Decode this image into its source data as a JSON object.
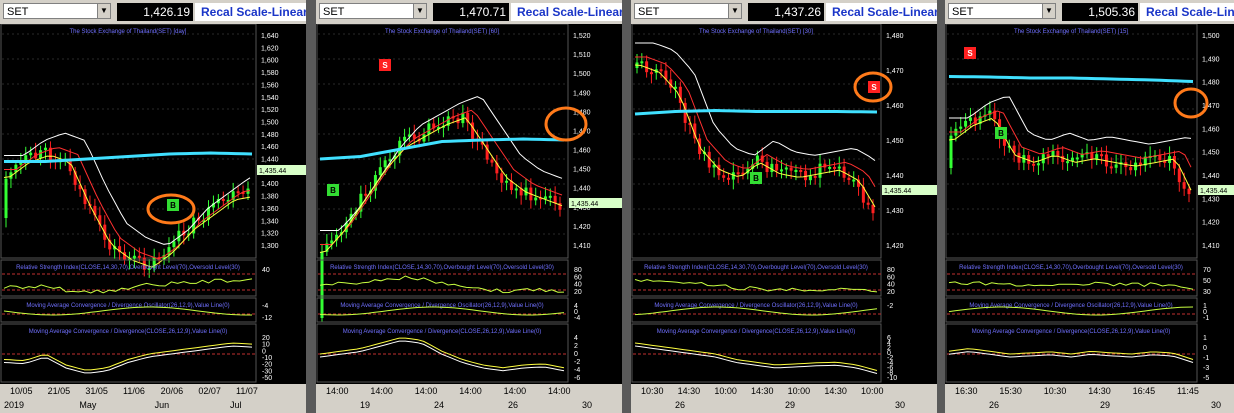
{
  "panels": [
    {
      "symbol": "SET",
      "price": "1,426.19",
      "recal_label": "Recal Scale-Linear",
      "chart_title": "The Stock Exchange of Thailand(SET) [day]",
      "price_axis": [
        "1,640",
        "1,620",
        "1,600",
        "1,580",
        "1,560",
        "1,540",
        "1,520",
        "1,500",
        "1,480",
        "1,460",
        "1,440",
        "1,420",
        "1,400",
        "1,380",
        "1,360",
        "1,340",
        "1,320",
        "1,300"
      ],
      "last_price_tag": "1,435.44",
      "rsi_label": "Relative Strength Index(CLOSE,14,30,70),Overbought Level(70),Oversold Level(30)",
      "rsi_axis": [
        "40"
      ],
      "macd_osc_label": "Moving Average Convergence / Divergence Oscillator(26,12,9),Value Line(0)",
      "macd_osc_axis": [
        "-4",
        "-12"
      ],
      "macd_label": "Moving Average Convergence / Divergence(CLOSE,26,12,9),Value Line(0)",
      "macd_axis": [
        "20",
        "10",
        "0",
        "-10",
        "-20",
        "-30",
        "-50"
      ],
      "time_labels": [
        "10/05",
        "21/05",
        "31/05",
        "11/06",
        "20/06",
        "02/07",
        "11/07"
      ],
      "date_labels": [
        "2019",
        "May",
        "Jun",
        "Jul"
      ],
      "signals": [
        {
          "type": "B",
          "text": "B"
        }
      ],
      "highlight": "buy-signal"
    },
    {
      "symbol": "SET",
      "price": "1,470.71",
      "recal_label": "Recal Scale-Linear",
      "chart_title": "The Stock Exchange of Thailand(SET) [60]",
      "price_axis": [
        "1,520",
        "1,510",
        "1,500",
        "1,490",
        "1,480",
        "1,470",
        "1,460",
        "1,450",
        "1,440",
        "1,430",
        "1,420",
        "1,410"
      ],
      "last_price_tag": "1,435.44",
      "rsi_label": "Relative Strength Index(CLOSE,14,30,70),Overbought Level(70),Oversold Level(30)",
      "rsi_axis": [
        "80",
        "60",
        "40",
        "20"
      ],
      "macd_osc_label": "Moving Average Convergence / Divergence Oscillator(26,12,9),Value Line(0)",
      "macd_osc_axis": [
        "4",
        "0",
        "-4"
      ],
      "macd_label": "Moving Average Convergence / Divergence(CLOSE,26,12,9),Value Line(0)",
      "macd_axis": [
        "4",
        "2",
        "0",
        "-2",
        "-4",
        "-6"
      ],
      "time_labels": [
        "14:00",
        "14:00",
        "14:00",
        "14:00",
        "14:00",
        "14:00"
      ],
      "date_labels": [
        "19",
        "24",
        "26",
        "30"
      ],
      "signals": [
        {
          "type": "B",
          "text": "B"
        },
        {
          "type": "S",
          "text": "S"
        }
      ],
      "highlight": "sell-signal"
    },
    {
      "symbol": "SET",
      "price": "1,437.26",
      "recal_label": "Recal Scale-Linear",
      "chart_title": "The Stock Exchange of Thailand(SET) [30]",
      "price_axis": [
        "1,480",
        "1,470",
        "1,460",
        "1,450",
        "1,440",
        "1,430",
        "1,420"
      ],
      "last_price_tag": "1,435.44",
      "rsi_label": "Relative Strength Index(CLOSE,14,30,70),Overbought Level(70),Oversold Level(30)",
      "rsi_axis": [
        "80",
        "60",
        "40",
        "20"
      ],
      "macd_osc_label": "Moving Average Convergence / Divergence Oscillator(26,12,9),Value Line(0)",
      "macd_osc_axis": [
        "-2"
      ],
      "macd_label": "Moving Average Convergence / Divergence(CLOSE,26,12,9),Value Line(0)",
      "macd_axis": [
        "6",
        "4",
        "2",
        "0",
        "-2",
        "-4",
        "-6",
        "-8",
        "-10"
      ],
      "time_labels": [
        "10:30",
        "14:30",
        "10:00",
        "14:30",
        "10:00",
        "14:30",
        "10:00"
      ],
      "date_labels": [
        "26",
        "29",
        "30"
      ],
      "signals": [
        {
          "type": "B",
          "text": "B"
        },
        {
          "type": "S",
          "text": "S"
        }
      ],
      "highlight": "sell-signal"
    },
    {
      "symbol": "SET",
      "price": "1,505.36",
      "recal_label": "Recal Scale-Linea",
      "chart_title": "The Stock Exchange of Thailand(SET) [15]",
      "price_axis": [
        "1,500",
        "1,490",
        "1,480",
        "1,470",
        "1,460",
        "1,450",
        "1,440",
        "1,430",
        "1,420",
        "1,410"
      ],
      "last_price_tag": "1,435.44",
      "rsi_label": "Relative Strength Index(CLOSE,14,30,70),Overbought Level(70),Oversold Level(30)",
      "rsi_axis": [
        "70",
        "50",
        "30"
      ],
      "macd_osc_label": "Moving Average Convergence / Divergence Oscillator(26,12,9),Value Line(0)",
      "macd_osc_axis": [
        "1",
        "0",
        "-1"
      ],
      "macd_label": "Moving Average Convergence / Divergence(CLOSE,26,12,9),Value Line(0)",
      "macd_axis": [
        "1",
        "0",
        "-1",
        "-3",
        "-5"
      ],
      "time_labels": [
        "16:30",
        "15:30",
        "10:30",
        "14:30",
        "16:45",
        "11:45"
      ],
      "date_labels": [
        "26",
        "29",
        "30"
      ],
      "signals": [
        {
          "type": "S",
          "text": "S"
        },
        {
          "type": "B",
          "text": "B"
        }
      ],
      "highlight": "sell-signal"
    }
  ],
  "colors": {
    "background": "#000000",
    "grid": "#2a2a2a",
    "up_candle": "#33ff33",
    "down_candle": "#ff2020",
    "long_ma": "#40e0ff",
    "ma_white": "#ffffff",
    "ma_red": "#ff3030",
    "ma_yellow": "#ffff40",
    "indicator_line": "#c8ff40",
    "title_text": "#7070ff",
    "highlight_ring": "#ff7a1a",
    "buy_marker": "#33dd33",
    "sell_marker": "#ff2020"
  }
}
